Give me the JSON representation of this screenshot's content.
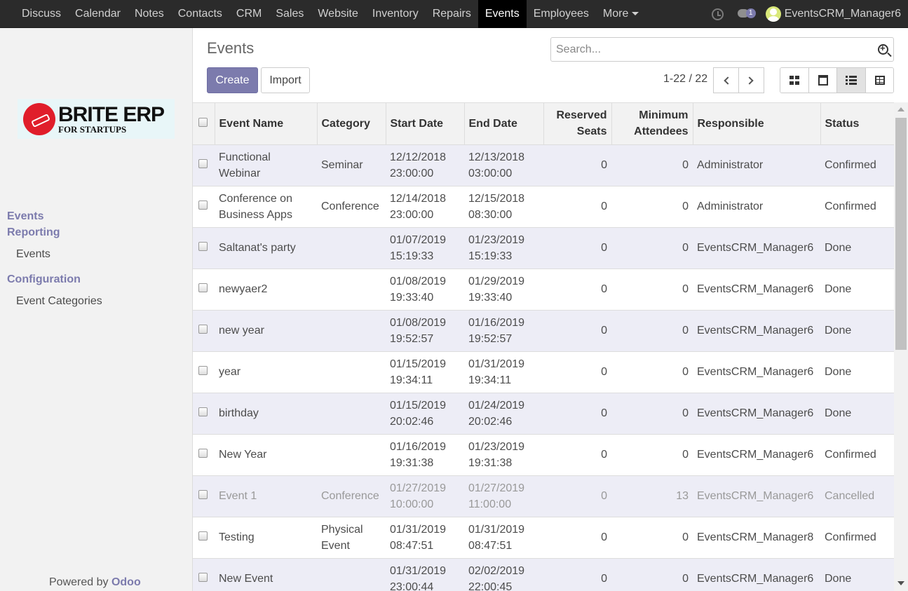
{
  "nav": {
    "items": [
      "Discuss",
      "Calendar",
      "Notes",
      "Contacts",
      "CRM",
      "Sales",
      "Website",
      "Inventory",
      "Repairs",
      "Events",
      "Employees"
    ],
    "more": "More",
    "active": "Events",
    "chat_badge": "1",
    "user": "EventsCRM_Manager6"
  },
  "sidebar": {
    "logo_main": "BRITE ERP",
    "logo_sub": "FOR STARTUPS",
    "sections": [
      {
        "label": "Events",
        "items": []
      },
      {
        "label": "Reporting",
        "items": [
          "Events"
        ]
      },
      {
        "label": "Configuration",
        "items": [
          "Event Categories"
        ]
      }
    ],
    "powered_prefix": "Powered by",
    "powered_brand": "Odoo"
  },
  "control": {
    "title": "Events",
    "search_placeholder": "Search...",
    "create_label": "Create",
    "import_label": "Import",
    "pager": "1-22 / 22"
  },
  "table": {
    "headers": [
      "Event Name",
      "Category",
      "Start Date",
      "End Date",
      "Reserved Seats",
      "Minimum Attendees",
      "Responsible",
      "Status"
    ],
    "rows": [
      {
        "name": "Functional Webinar",
        "category": "Seminar",
        "start": "12/12/2018 23:00:00",
        "end": "12/13/2018 03:00:00",
        "seats": "0",
        "min": "0",
        "responsible": "Administrator",
        "status": "Confirmed"
      },
      {
        "name": "Conference on Business Apps",
        "category": "Conference",
        "start": "12/14/2018 23:00:00",
        "end": "12/15/2018 08:30:00",
        "seats": "0",
        "min": "0",
        "responsible": "Administrator",
        "status": "Confirmed"
      },
      {
        "name": "Saltanat's party",
        "category": "",
        "start": "01/07/2019 15:19:33",
        "end": "01/23/2019 15:19:33",
        "seats": "0",
        "min": "0",
        "responsible": "EventsCRM_Manager6",
        "status": "Done"
      },
      {
        "name": "newyaer2",
        "category": "",
        "start": "01/08/2019 19:33:40",
        "end": "01/29/2019 19:33:40",
        "seats": "0",
        "min": "0",
        "responsible": "EventsCRM_Manager6",
        "status": "Done"
      },
      {
        "name": "new year",
        "category": "",
        "start": "01/08/2019 19:52:57",
        "end": "01/16/2019 19:52:57",
        "seats": "0",
        "min": "0",
        "responsible": "EventsCRM_Manager6",
        "status": "Done"
      },
      {
        "name": "year",
        "category": "",
        "start": "01/15/2019 19:34:11",
        "end": "01/31/2019 19:34:11",
        "seats": "0",
        "min": "0",
        "responsible": "EventsCRM_Manager6",
        "status": "Done"
      },
      {
        "name": "birthday",
        "category": "",
        "start": "01/15/2019 20:02:46",
        "end": "01/24/2019 20:02:46",
        "seats": "0",
        "min": "0",
        "responsible": "EventsCRM_Manager6",
        "status": "Done"
      },
      {
        "name": "New Year",
        "category": "",
        "start": "01/16/2019 19:31:38",
        "end": "01/23/2019 19:31:38",
        "seats": "0",
        "min": "0",
        "responsible": "EventsCRM_Manager6",
        "status": "Confirmed"
      },
      {
        "name": "Event 1",
        "category": "Conference",
        "start": "01/27/2019 10:00:00",
        "end": "01/27/2019 11:00:00",
        "seats": "0",
        "min": "13",
        "responsible": "EventsCRM_Manager6",
        "status": "Cancelled",
        "muted": true
      },
      {
        "name": "Testing",
        "category": "Physical Event",
        "start": "01/31/2019 08:47:51",
        "end": "01/31/2019 08:47:51",
        "seats": "0",
        "min": "0",
        "responsible": "EventsCRM_Manager8",
        "status": "Confirmed"
      },
      {
        "name": "New Event",
        "category": "",
        "start": "01/31/2019 23:00:44",
        "end": "02/02/2019 22:00:45",
        "seats": "0",
        "min": "0",
        "responsible": "EventsCRM_Manager6",
        "status": "Done"
      }
    ]
  }
}
